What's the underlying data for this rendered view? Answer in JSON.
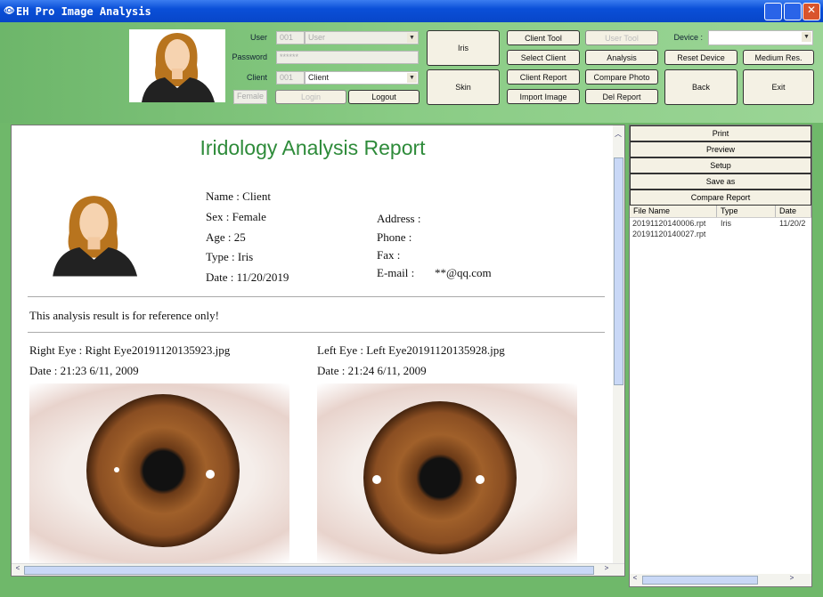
{
  "window": {
    "title": "EH Pro Image Analysis"
  },
  "login": {
    "user_label": "User",
    "user_id": "001",
    "user_value": "User",
    "password_label": "Password",
    "password_value": "******",
    "client_label": "Client",
    "client_id": "001",
    "client_value": "Client",
    "gender": "Female",
    "login": "Login",
    "logout": "Logout"
  },
  "toolbar": {
    "iris": "Iris",
    "skin": "Skin",
    "client_tool": "Client Tool",
    "user_tool": "User Tool",
    "select_client": "Select Client",
    "analysis": "Analysis",
    "client_report": "Client Report",
    "compare_photo": "Compare Photo",
    "import_image": "Import Image",
    "del_report": "Del Report",
    "device_label": "Device :",
    "device_value": "",
    "reset_device": "Reset Device",
    "medium_res": "Medium Res.",
    "back": "Back",
    "exit": "Exit"
  },
  "report": {
    "title": "Iridology Analysis Report",
    "title_color": "#2e8b3a",
    "name": "Name : Client",
    "sex": "Sex : Female",
    "age": "Age : 25",
    "type": "Type : Iris",
    "date": "Date : 11/20/2019",
    "address": "Address :",
    "phone": "Phone :",
    "fax": "Fax :",
    "email_label": "E-mail :",
    "email": "**@qq.com",
    "note": "This analysis result is for reference only!",
    "right_eye": "Right Eye : Right Eye20191120135923.jpg",
    "right_date": "Date : 21:23 6/11, 2009",
    "left_eye": "Left Eye : Left Eye20191120135928.jpg",
    "left_date": "Date : 21:24 6/11, 2009"
  },
  "side": {
    "buttons": [
      "Print",
      "Preview",
      "Setup",
      "Save as",
      "Compare Report"
    ],
    "columns": [
      "File Name",
      "Type",
      "Date"
    ],
    "files": [
      {
        "name": "20191120140006.rpt",
        "type": "Iris",
        "date": "11/20/2"
      },
      {
        "name": "20191120140027.rpt",
        "type": "",
        "date": ""
      }
    ]
  }
}
